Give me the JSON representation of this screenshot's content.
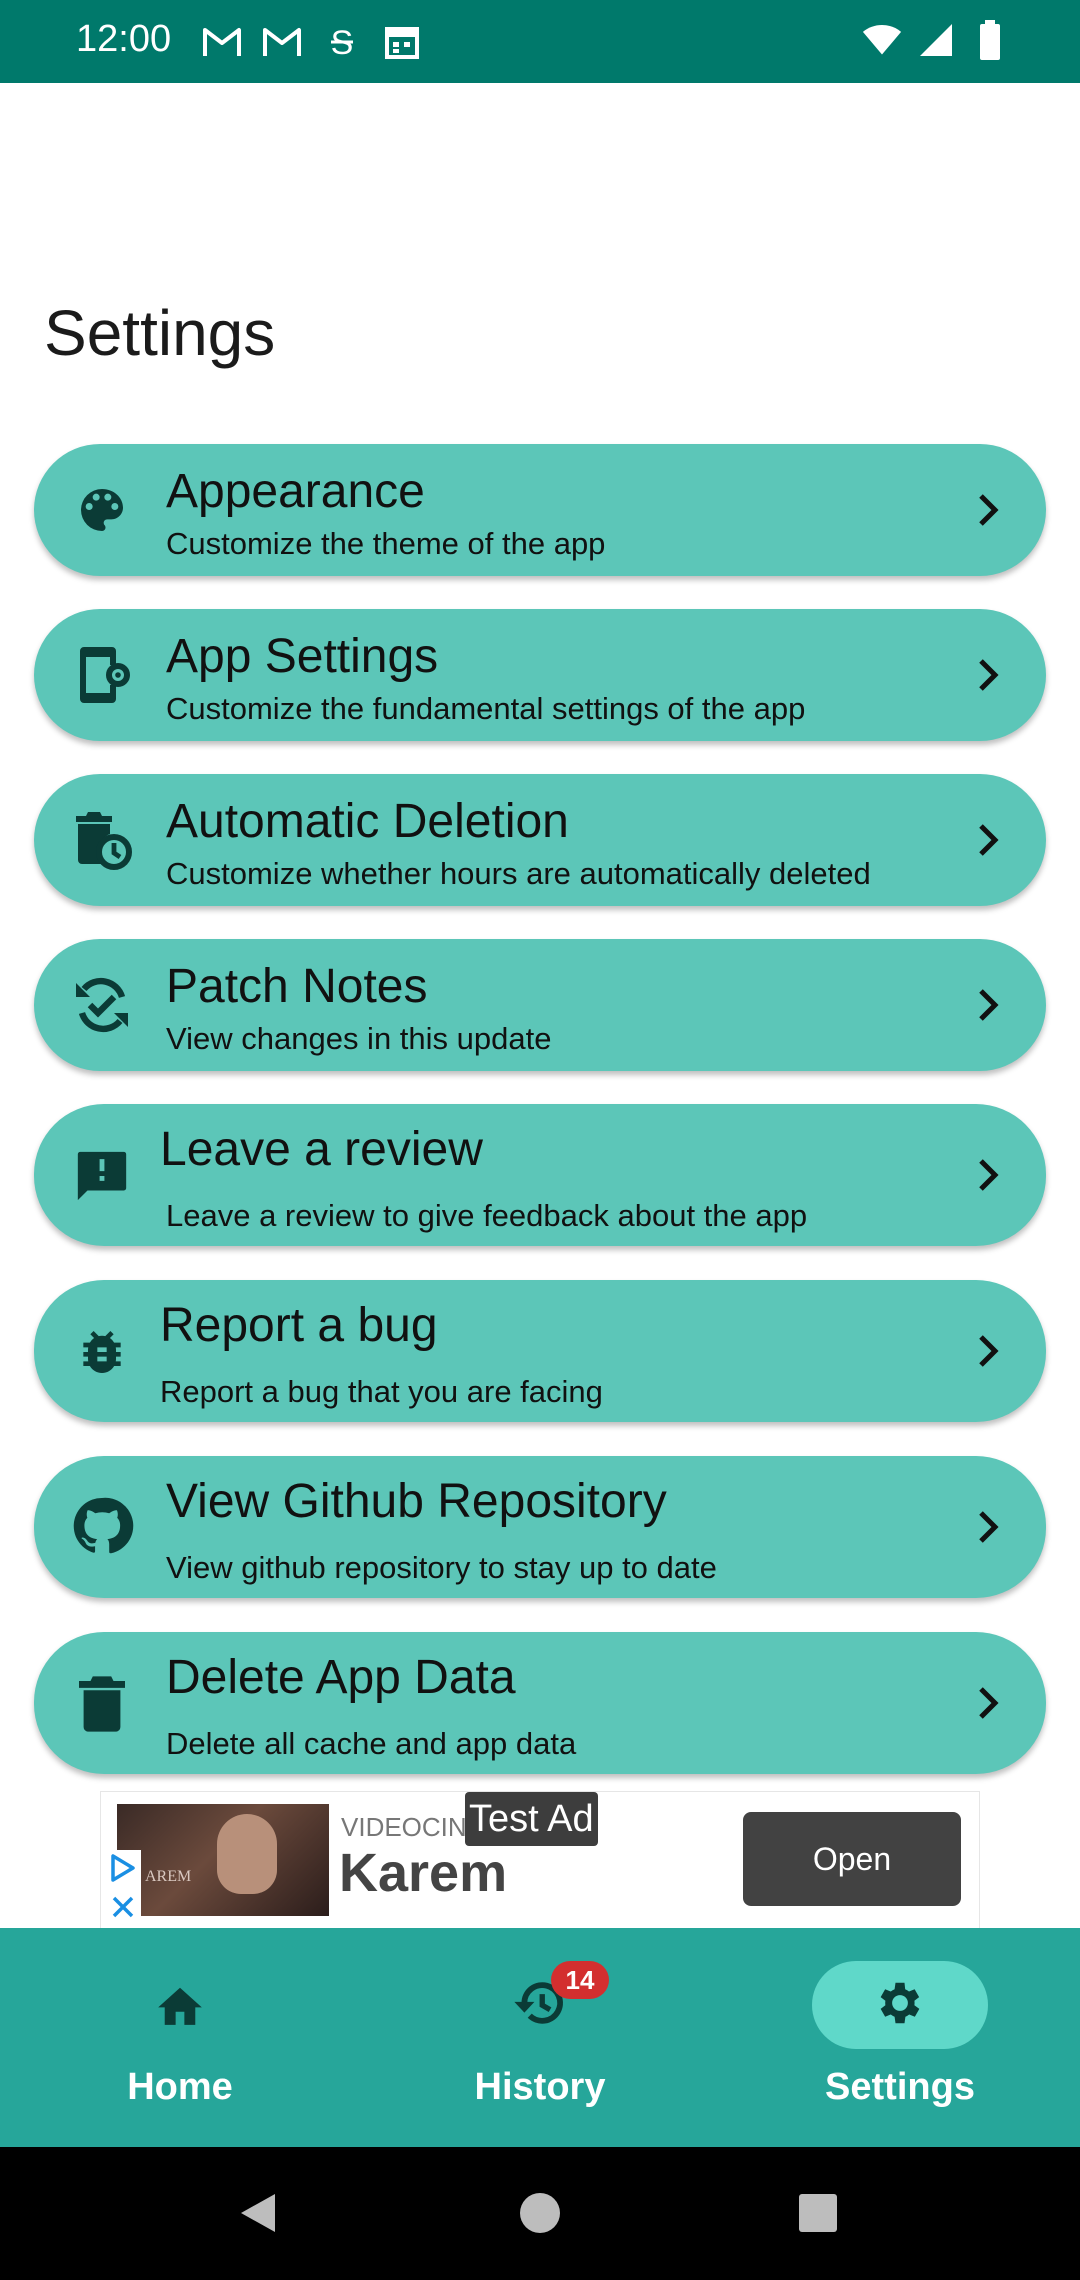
{
  "status_bar": {
    "time": "12:00",
    "left_icons": [
      "gmail-icon",
      "gmail-icon",
      "sim-icon",
      "calendar-icon"
    ],
    "right_icons": [
      "wifi-icon",
      "signal-icon",
      "battery-icon"
    ]
  },
  "page": {
    "title": "Settings"
  },
  "settings": [
    {
      "title": "Appearance",
      "subtitle": "Customize the theme of the app",
      "icon": "palette-icon"
    },
    {
      "title": "App Settings",
      "subtitle": "Customize the fundamental settings of the app",
      "icon": "phone-settings-icon"
    },
    {
      "title": "Automatic Deletion",
      "subtitle": "Customize whether hours are automatically deleted",
      "icon": "timed-delete-icon"
    },
    {
      "title": "Patch Notes",
      "subtitle": "View changes in this update",
      "icon": "update-check-icon"
    },
    {
      "title": "Leave a review",
      "subtitle": "Leave a review to give feedback about the app",
      "icon": "feedback-icon"
    },
    {
      "title": "Report a bug",
      "subtitle": "Report a bug that you are facing",
      "icon": "bug-icon"
    },
    {
      "title": "View Github Repository",
      "subtitle": "View github repository to stay up to date",
      "icon": "github-icon"
    },
    {
      "title": "Delete App Data",
      "subtitle": "Delete all cache and app data",
      "icon": "trash-icon"
    }
  ],
  "ad": {
    "test_label": "Test Ad",
    "advertiser": "VIDEOCINE",
    "brand": "Karem",
    "thumb_caption": "AREM",
    "cta": "Open"
  },
  "bottom_nav": {
    "items": [
      {
        "label": "Home",
        "icon": "home-icon"
      },
      {
        "label": "History",
        "icon": "history-icon",
        "badge": "14"
      },
      {
        "label": "Settings",
        "icon": "gear-icon",
        "active": true
      }
    ]
  },
  "colors": {
    "status_bar": "#00796b",
    "card": "#5cc6b8",
    "bottom_nav": "#26a69a",
    "active_pill": "#5fd8c9",
    "icon_dark": "#0b3b36",
    "badge": "#d32f2f"
  }
}
